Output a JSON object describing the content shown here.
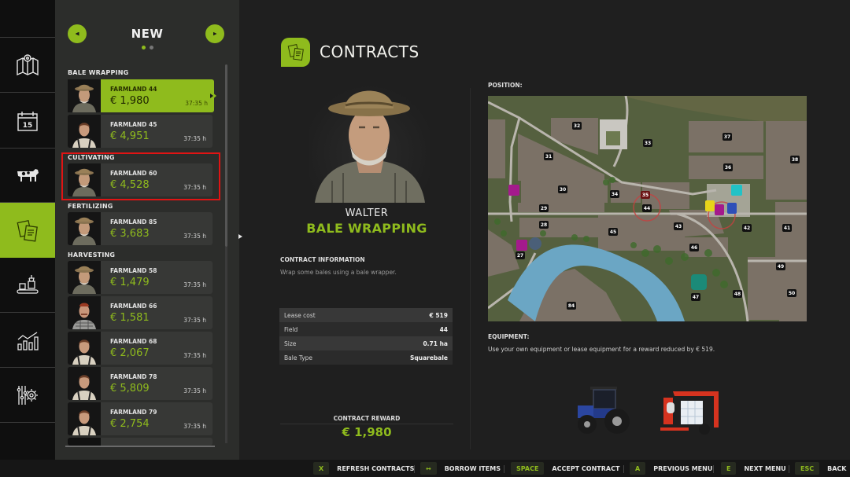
{
  "nav_rail": {
    "items": [
      {
        "icon": "map-icon",
        "label": "Map"
      },
      {
        "icon": "calendar-icon",
        "label": "Calendar",
        "day": "15"
      },
      {
        "icon": "cow-icon",
        "label": "Animals"
      },
      {
        "icon": "contracts-icon",
        "label": "Contracts",
        "active": true
      },
      {
        "icon": "production-icon",
        "label": "Production"
      },
      {
        "icon": "statistics-icon",
        "label": "Statistics"
      },
      {
        "icon": "settings-icon",
        "label": "Settings"
      }
    ]
  },
  "contract_list": {
    "title": "NEW",
    "page_count": 2,
    "current_page": 1,
    "categories": [
      {
        "label": "BALE WRAPPING",
        "items": [
          {
            "field": "FARMLAND 44",
            "reward": "€ 1,980",
            "time": "37:35 h",
            "npc": "old-man",
            "selected": true
          },
          {
            "field": "FARMLAND 45",
            "reward": "€ 4,951",
            "time": "37:35 h",
            "npc": "young-woman"
          }
        ]
      },
      {
        "label": "CULTIVATING",
        "items": [
          {
            "field": "FARMLAND 60",
            "reward": "€ 4,528",
            "time": "37:35 h",
            "npc": "old-man",
            "highlighted": true
          }
        ]
      },
      {
        "label": "FERTILIZING",
        "items": [
          {
            "field": "FARMLAND 85",
            "reward": "€ 3,683",
            "time": "37:35 h",
            "npc": "old-man"
          }
        ]
      },
      {
        "label": "HARVESTING",
        "items": [
          {
            "field": "FARMLAND 58",
            "reward": "€ 1,479",
            "time": "37:35 h",
            "npc": "old-man"
          },
          {
            "field": "FARMLAND 66",
            "reward": "€ 1,581",
            "time": "37:35 h",
            "npc": "red-hair-man"
          },
          {
            "field": "FARMLAND 68",
            "reward": "€ 2,067",
            "time": "37:35 h",
            "npc": "young-woman"
          },
          {
            "field": "FARMLAND 78",
            "reward": "€ 5,809",
            "time": "37:35 h",
            "npc": "young-woman"
          },
          {
            "field": "FARMLAND 79",
            "reward": "€ 2,754",
            "time": "37:35 h",
            "npc": "young-woman"
          }
        ]
      }
    ]
  },
  "header": {
    "title": "CONTRACTS",
    "icon": "contracts-icon"
  },
  "contract": {
    "npc_name": "WALTER",
    "type": "BALE WRAPPING",
    "info_title": "CONTRACT INFORMATION",
    "info_desc": "Wrap some bales using a bale wrapper.",
    "details": [
      {
        "key": "Lease cost",
        "value": "€ 519"
      },
      {
        "key": "Field",
        "value": "44"
      },
      {
        "key": "Size",
        "value": "0.71 ha"
      },
      {
        "key": "Bale Type",
        "value": "Squarebale"
      }
    ],
    "reward_label": "CONTRACT REWARD",
    "reward_value": "€ 1,980"
  },
  "position": {
    "label": "POSITION:",
    "highlighted_field": "44",
    "field_labels": [
      "32",
      "33",
      "31",
      "37",
      "36",
      "38",
      "30",
      "34",
      "35",
      "44",
      "29",
      "28",
      "45",
      "43",
      "42",
      "41",
      "27",
      "46",
      "49",
      "47",
      "48",
      "50",
      "84"
    ]
  },
  "equipment": {
    "label": "EQUIPMENT:",
    "desc": "Use your own equipment or lease equipment for a reward reduced by € 519.",
    "items": [
      "tractor",
      "bale-wrapper"
    ]
  },
  "bottom_bar": {
    "hints": [
      {
        "key": "X",
        "label": "REFRESH CONTRACTS"
      },
      {
        "key": "↔",
        "label": "BORROW ITEMS"
      },
      {
        "key": "SPACE",
        "label": "ACCEPT CONTRACT"
      },
      {
        "key": "A",
        "label": "PREVIOUS MENU"
      },
      {
        "key": "E",
        "label": "NEXT MENU"
      },
      {
        "key": "ESC",
        "label": "BACK"
      }
    ]
  },
  "colors": {
    "accent": "#8fbb1d",
    "highlight_box": "#e01414",
    "background": "#1f1f1f",
    "panel": "#2c2d2b"
  }
}
